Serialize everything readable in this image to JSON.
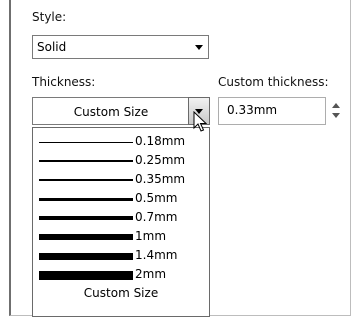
{
  "style": {
    "label": "Style:",
    "selected": "Solid"
  },
  "thickness": {
    "label": "Thickness:",
    "selected": "Custom Size",
    "options": [
      {
        "label": "0.18mm",
        "weight": 1
      },
      {
        "label": "0.25mm",
        "weight": 1.5
      },
      {
        "label": "0.35mm",
        "weight": 2
      },
      {
        "label": "0.5mm",
        "weight": 3
      },
      {
        "label": "0.7mm",
        "weight": 4
      },
      {
        "label": "1mm",
        "weight": 6
      },
      {
        "label": "1.4mm",
        "weight": 7
      },
      {
        "label": "2mm",
        "weight": 9
      }
    ],
    "custom_option": "Custom Size"
  },
  "custom_thickness": {
    "label": "Custom thickness:",
    "value": "0.33mm"
  }
}
